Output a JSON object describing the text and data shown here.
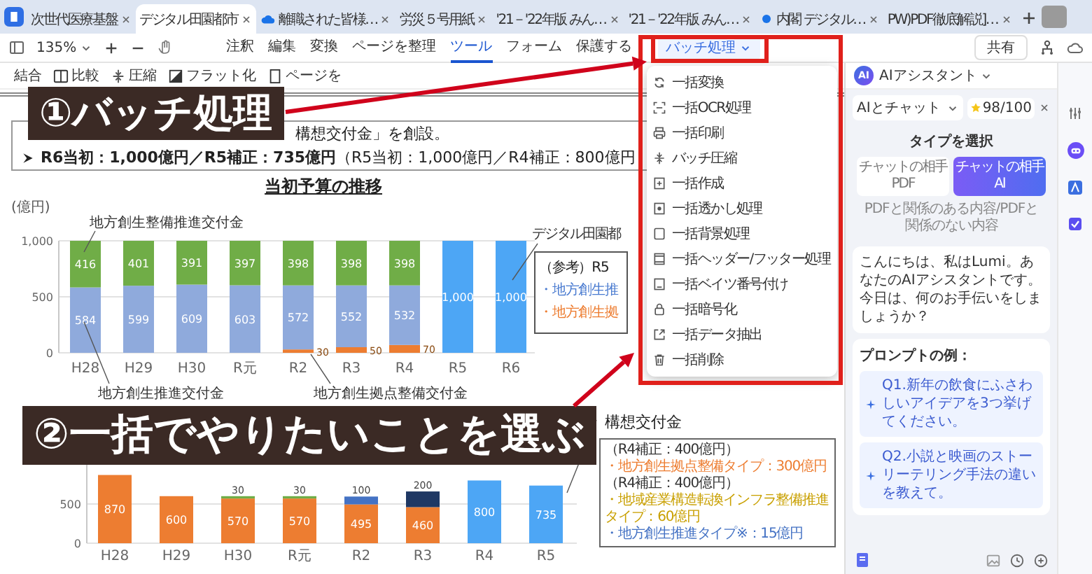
{
  "tabs": [
    {
      "label": "次世代医療基盤",
      "selected": false
    },
    {
      "label": "デジタル田園都市",
      "selected": true
    },
    {
      "label": "離職された皆様…",
      "selected": false
    },
    {
      "label": "労災５号用紙",
      "selected": false
    },
    {
      "label": "'21－'22年版 みん…",
      "selected": false
    },
    {
      "label": "'21－'22年版 みん…",
      "selected": false
    },
    {
      "label": "内閣 デジタル…",
      "selected": false
    },
    {
      "label": "PW)PDF徹底解説]…",
      "selected": false
    }
  ],
  "toolbar": {
    "zoom": "135%",
    "menus": [
      {
        "label": "注釈",
        "selected": false
      },
      {
        "label": "編集",
        "selected": false
      },
      {
        "label": "変換",
        "selected": false
      },
      {
        "label": "ページを整理",
        "selected": false
      },
      {
        "label": "ツール",
        "selected": true
      },
      {
        "label": "フォーム",
        "selected": false
      },
      {
        "label": "保護する",
        "selected": false
      }
    ],
    "batch_button": {
      "label": "バッチ処理",
      "expanded": true
    },
    "share": "共有"
  },
  "tools": [
    "結合",
    "比較",
    "圧縮",
    "フラット化",
    "ページを"
  ],
  "callouts": [
    "①バッチ処理",
    "②一括でやりたいことを選ぶ"
  ],
  "batch_menu": [
    "一括変換",
    "一括OCR処理",
    "一括印刷",
    "バッチ圧縮",
    "一括作成",
    "一括透かし処理",
    "一括背景処理",
    "一括ヘッダー/フッター処理",
    "一括ベイツ番号付け",
    "一括暗号化",
    "一括データ抽出",
    "一括削除"
  ],
  "document": {
    "lines": [
      {
        "kind": "continued",
        "text": "構想交付金」を創設。"
      },
      {
        "kind": "full",
        "text": "**R6当初：1,000億円／R5補正：735億円**（R5当初：1,000億円／R4補正：800億円"
      }
    ],
    "chart_1": {
      "title": "当初予算の推移",
      "chart_data": {
        "type": "bar",
        "stacked": true,
        "ylabel": "(億円)",
        "categories": [
          "H28",
          "H29",
          "H30",
          "R元",
          "R2",
          "R3",
          "R4",
          "R5",
          "R6"
        ],
        "ylim": [
          0,
          1000
        ],
        "yticks": [
          0,
          500,
          {
            "value": 1000,
            "label": "1,000"
          }
        ],
        "series": [
          {
            "name": "地方創生拠点整備交付金",
            "color": "#ed7d31",
            "values": [
              null,
              null,
              null,
              null,
              30,
              50,
              70,
              null,
              null
            ]
          },
          {
            "name": "地方創生推進交付金",
            "color": "#8faadc",
            "values": [
              584,
              599,
              609,
              603,
              572,
              552,
              532,
              null,
              null
            ]
          },
          {
            "name": "地方創生整備推進交付金",
            "color": "#70ad47",
            "values": [
              416,
              401,
              391,
              397,
              398,
              398,
              398,
              null,
              null
            ]
          },
          {
            "name": "デジタル田園都",
            "color": "#4da6f5",
            "values": [
              null,
              null,
              null,
              null,
              null,
              null,
              null,
              1000,
              1000
            ]
          }
        ],
        "value_labels": [
          [
            null,
            null,
            null,
            null,
            "30",
            "50",
            "70",
            null,
            null
          ],
          [
            "584",
            "599",
            "609",
            "603",
            "572",
            "552",
            "532",
            null,
            null
          ],
          [
            "416",
            "401",
            "391",
            "397",
            "398",
            "398",
            "398",
            null,
            null
          ],
          [
            null,
            null,
            null,
            null,
            null,
            null,
            null,
            "1,000",
            "1,000"
          ]
        ]
      },
      "reference_lines": [
        {
          "text": "（参考）R5",
          "color": "#222222"
        },
        {
          "text": "・地方創生推",
          "color": "#4a7bd0"
        },
        {
          "text": "・地方創生拠",
          "color": "#ed7d31"
        }
      ]
    },
    "chart_2": {
      "label": "構想交付金",
      "chart_data": {
        "type": "bar",
        "stacked": true,
        "categories": [
          "H28",
          "H29",
          "H30",
          "R元",
          "R2",
          "R3",
          "R4",
          "R5"
        ],
        "ylim": [
          0,
          1000
        ],
        "yticks": [
          0,
          500
        ],
        "series": [
          {
            "color": "#ed7d31",
            "values": [
              870,
              600,
              570,
              570,
              495,
              460,
              null,
              null
            ]
          },
          {
            "color": "#70ad47",
            "values": [
              null,
              null,
              30,
              30,
              null,
              null,
              null,
              null
            ]
          },
          {
            "color": "#4472c4",
            "values": [
              null,
              null,
              null,
              null,
              100,
              null,
              null,
              null
            ]
          },
          {
            "color": "#1f3864",
            "values": [
              null,
              null,
              null,
              null,
              null,
              200,
              null,
              null
            ]
          },
          {
            "color": "#4da6f5",
            "values": [
              null,
              null,
              null,
              null,
              null,
              null,
              800,
              735
            ]
          }
        ],
        "value_labels": [
          [
            "870",
            "600",
            "570",
            "570",
            "495",
            "460",
            null,
            null
          ],
          [
            null,
            null,
            "30",
            "30",
            null,
            null,
            null,
            null
          ],
          [
            null,
            null,
            null,
            null,
            "100",
            null,
            null,
            null
          ],
          [
            null,
            null,
            null,
            null,
            null,
            "200",
            null,
            null
          ],
          [
            null,
            null,
            null,
            null,
            null,
            null,
            "800",
            "735"
          ]
        ]
      },
      "notes": [
        {
          "text": "（R4補正：400億円）",
          "color": "#333333"
        },
        {
          "text": "・地方創生拠点整備タイプ：300億円",
          "color": "#ed7d31"
        },
        {
          "text": "（R4補正：400億円）",
          "color": "#333333"
        },
        {
          "text": "・地域産業構造転換インフラ整備推進タイプ：60億円",
          "color": "#c9a000"
        },
        {
          "text": "・地方創生推進タイプ※：15億円",
          "color": "#4472c4"
        }
      ]
    }
  },
  "ai_panel": {
    "badge": "AI",
    "title": "AIアシスタント",
    "mode": "AIとチャット",
    "quota": "98/100",
    "type_heading": "タイプを選択",
    "chat_types": [
      {
        "caption": "チャットの相手",
        "label": "PDF",
        "selected": false
      },
      {
        "caption": "チャットの相手",
        "label": "AI",
        "selected": true
      }
    ],
    "type_hint": "PDFと関係のある内容/PDFと関係のない内容",
    "greeting": "こんにちは、私はLumi。あなたのAIアシスタントです。今日は、何のお手伝いをしましょうか？",
    "prompts_heading": "プロンプトの例：",
    "prompts": [
      "Q1.新年の飲食にふさわしいアイデアを3つ挙げてください。",
      "Q2.小説と映画のストーリーテリング手法の違いを教えて。"
    ]
  }
}
